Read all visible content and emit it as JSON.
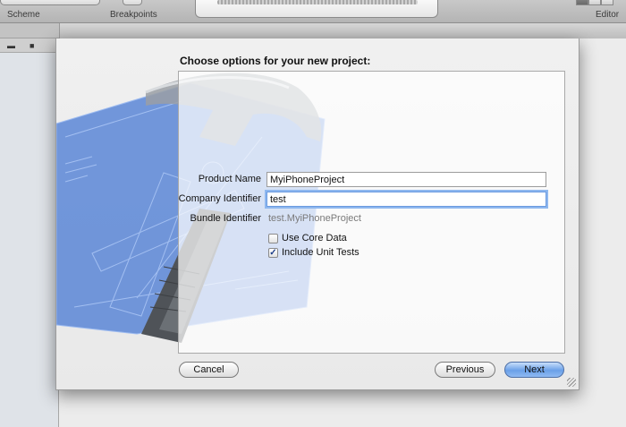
{
  "toolbar": {
    "scheme_label": "Scheme",
    "breakpoints_label": "Breakpoints",
    "editor_label": "Editor"
  },
  "sheet": {
    "title": "Choose options for your new project:",
    "fields": {
      "product_name": {
        "label": "Product Name",
        "value": "MyiPhoneProject"
      },
      "company_identifier": {
        "label": "Company Identifier",
        "value": "test"
      },
      "bundle_identifier": {
        "label": "Bundle Identifier",
        "value": "test.MyiPhoneProject"
      }
    },
    "checkboxes": [
      {
        "label": "Use Core Data",
        "checked": false
      },
      {
        "label": "Include Unit Tests",
        "checked": true
      }
    ],
    "buttons": {
      "cancel": "Cancel",
      "previous": "Previous",
      "next": "Next"
    }
  },
  "colors": {
    "blueprint": "#5b86d6",
    "accent": "#6aa0e8"
  },
  "icons": [
    "hammer-blueprint-icon",
    "run-icon",
    "comment-icon",
    "checkmark-icon",
    "resize-grip-icon"
  ]
}
